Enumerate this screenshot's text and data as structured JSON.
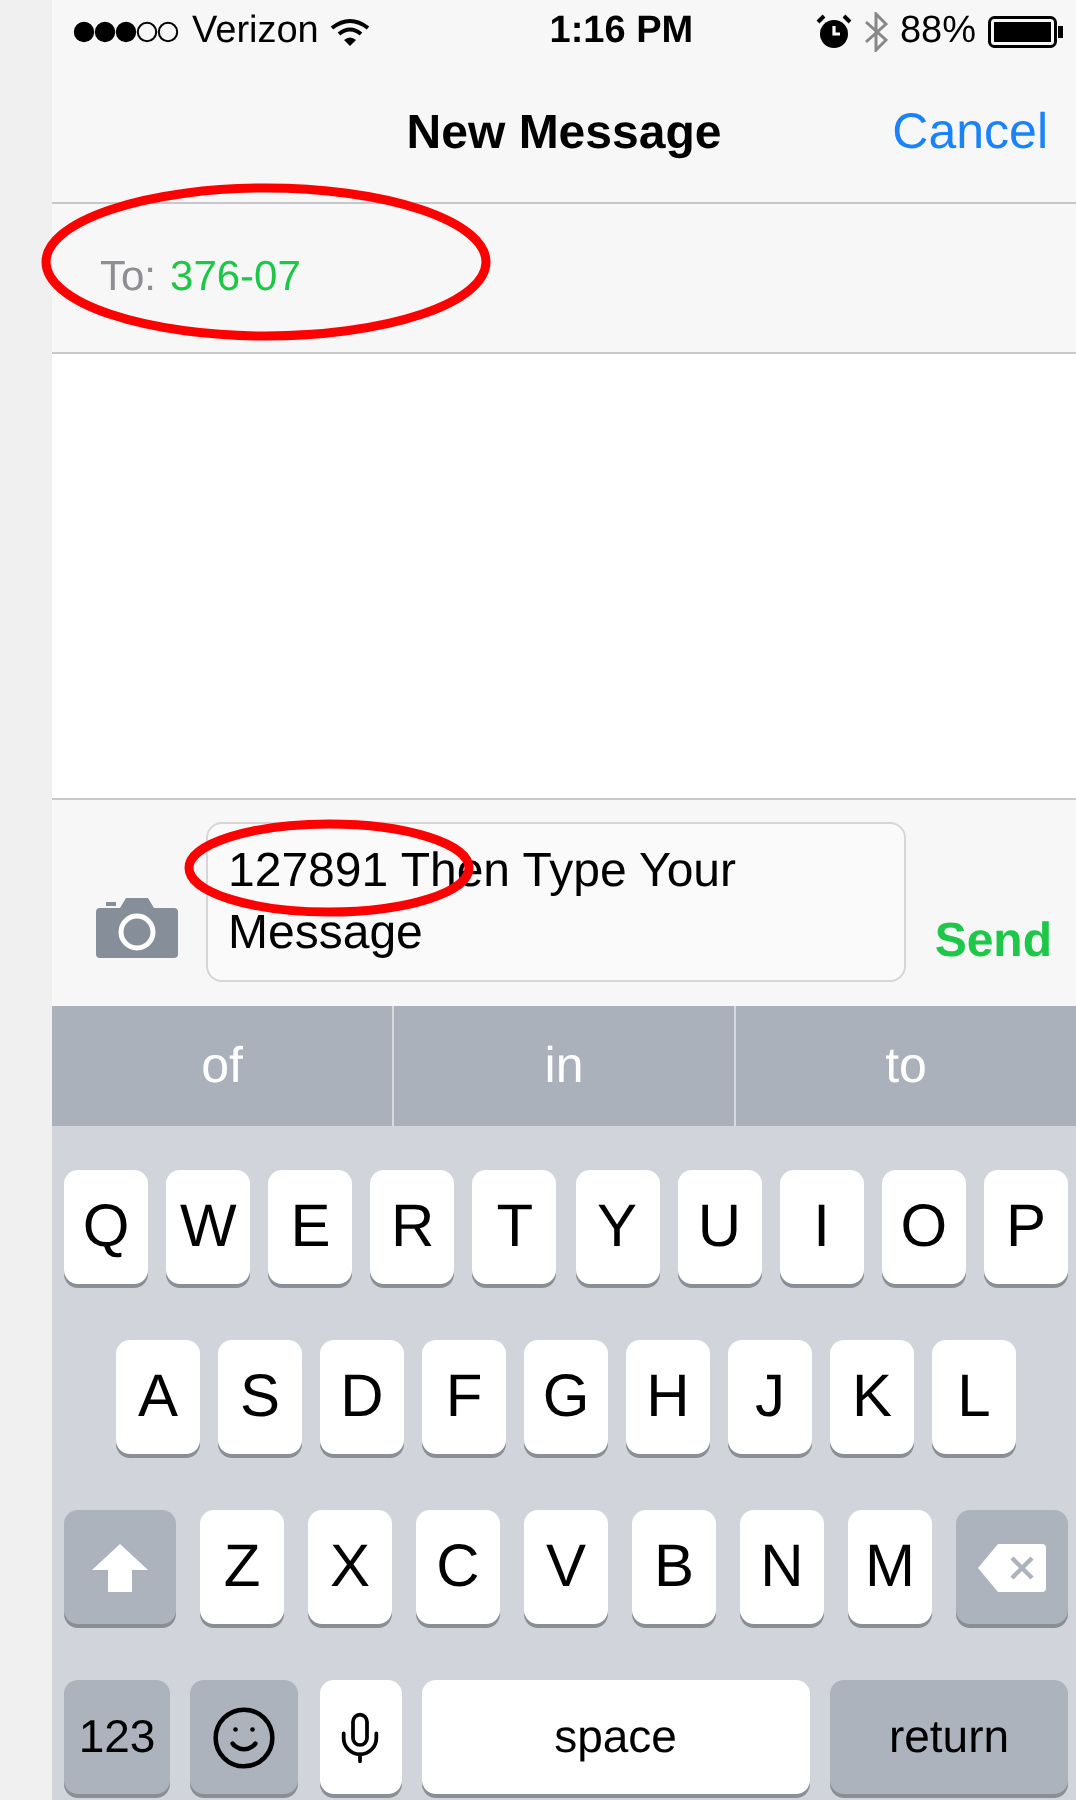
{
  "status_bar": {
    "carrier": "Verizon",
    "time": "1:16 PM",
    "battery": "88%"
  },
  "nav": {
    "title": "New Message",
    "cancel": "Cancel"
  },
  "recipient": {
    "label": "To:",
    "value": "376-07",
    "circled": true
  },
  "compose": {
    "value": "127891 Then Type Your Message",
    "start_circled": true,
    "send": "Send"
  },
  "suggestions": [
    {
      "text": "of"
    },
    {
      "text": "in"
    },
    {
      "text": "to"
    }
  ],
  "keyboard": {
    "rows": [
      {
        "keys": [
          {
            "kind": "letter",
            "label": "Q"
          },
          {
            "kind": "letter",
            "label": "W"
          },
          {
            "kind": "letter",
            "label": "E"
          },
          {
            "kind": "letter",
            "label": "R"
          },
          {
            "kind": "letter",
            "label": "T"
          },
          {
            "kind": "letter",
            "label": "Y"
          },
          {
            "kind": "letter",
            "label": "U"
          },
          {
            "kind": "letter",
            "label": "I"
          },
          {
            "kind": "letter",
            "label": "O"
          },
          {
            "kind": "letter",
            "label": "P"
          }
        ]
      },
      {
        "keys": [
          {
            "kind": "letter",
            "label": "A"
          },
          {
            "kind": "letter",
            "label": "S"
          },
          {
            "kind": "letter",
            "label": "D"
          },
          {
            "kind": "letter",
            "label": "F"
          },
          {
            "kind": "letter",
            "label": "G"
          },
          {
            "kind": "letter",
            "label": "H"
          },
          {
            "kind": "letter",
            "label": "J"
          },
          {
            "kind": "letter",
            "label": "K"
          },
          {
            "kind": "letter",
            "label": "L"
          }
        ]
      },
      {
        "keys": [
          {
            "kind": "shift"
          },
          {
            "kind": "letter",
            "label": "Z"
          },
          {
            "kind": "letter",
            "label": "X"
          },
          {
            "kind": "letter",
            "label": "C"
          },
          {
            "kind": "letter",
            "label": "V"
          },
          {
            "kind": "letter",
            "label": "B"
          },
          {
            "kind": "letter",
            "label": "N"
          },
          {
            "kind": "letter",
            "label": "M"
          },
          {
            "kind": "delete"
          }
        ]
      },
      {
        "keys": [
          {
            "kind": "numbers",
            "label": "123"
          },
          {
            "kind": "emoji"
          },
          {
            "kind": "mic"
          },
          {
            "kind": "space",
            "label": "space"
          },
          {
            "kind": "return",
            "label": "return"
          }
        ]
      }
    ]
  }
}
